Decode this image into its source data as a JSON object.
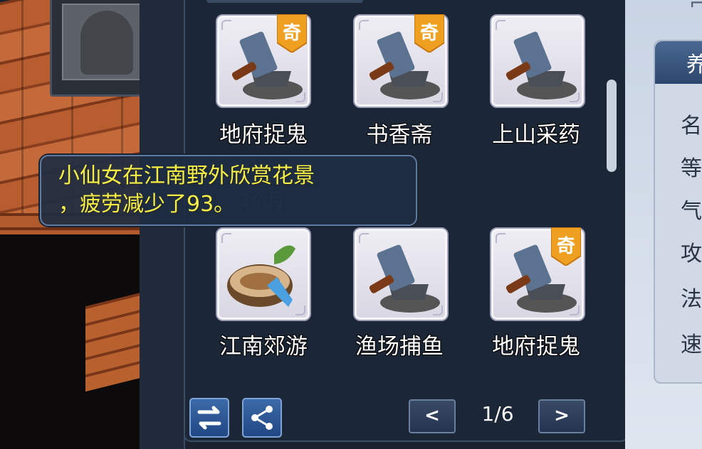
{
  "grid": {
    "row1": [
      {
        "label": "地府捉鬼",
        "icon": "hammer-anvil-icon",
        "badge": "奇"
      },
      {
        "label": "书香斋",
        "icon": "hammer-anvil-icon",
        "badge": "奇"
      },
      {
        "label": "上山采药",
        "icon": "hammer-anvil-icon",
        "badge": ""
      }
    ],
    "row2": [
      {
        "label": "江南郊游",
        "icon": "tea-bowl-icon",
        "badge": ""
      },
      {
        "label": "渔场捕鱼",
        "icon": "hammer-anvil-icon",
        "badge": ""
      },
      {
        "label": "地府捉鬼",
        "icon": "hammer-anvil-icon",
        "badge": "奇"
      }
    ]
  },
  "tooltip": {
    "text": "小仙女在江南野外欣赏花景\n，疲劳减少了93。"
  },
  "pager": {
    "prev": "<",
    "next": ">",
    "page": "1/6"
  },
  "right_panel": {
    "tab": "养",
    "rows": [
      "名",
      "等",
      "气",
      "攻",
      "法",
      "速"
    ]
  },
  "colors": {
    "tooltip_text": "#f4ee46",
    "badge": "#f0a020",
    "panel": "#1b2636"
  }
}
